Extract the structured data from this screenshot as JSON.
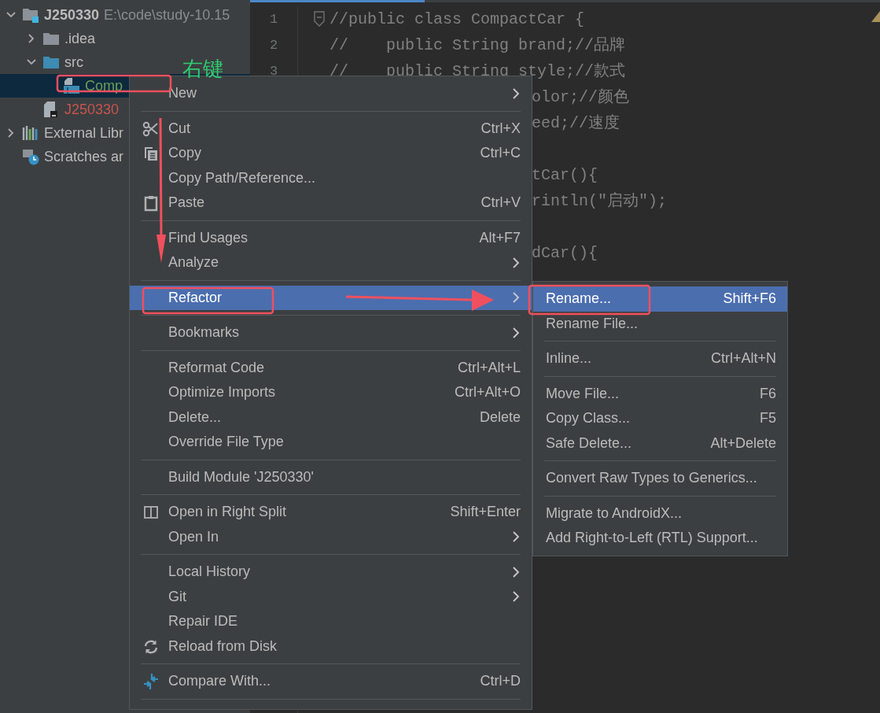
{
  "project_tree": {
    "items": [
      {
        "kind": "module",
        "label": "J250330",
        "path": "E:\\code\\study-10.15",
        "expanded": true,
        "selected": false,
        "children": [
          {
            "kind": "folder",
            "label": ".idea",
            "expanded": false,
            "selected": false
          },
          {
            "kind": "source_folder",
            "label": "src",
            "expanded": true,
            "selected": false,
            "children": [
              {
                "kind": "class",
                "label": "Comp",
                "selected": true
              }
            ]
          },
          {
            "kind": "file",
            "label": "J250330",
            "selected": false
          }
        ]
      },
      {
        "kind": "library",
        "label": "External Libr",
        "expanded": false,
        "selected": false
      },
      {
        "kind": "scratches",
        "label": "Scratches ar",
        "selected": false
      }
    ]
  },
  "editor": {
    "lines": [
      {
        "number": "1",
        "kind": "full",
        "text": "//public class CompactCar {"
      },
      {
        "number": "2",
        "kind": "full",
        "text": "//    public String brand;//品牌"
      },
      {
        "number": "3",
        "kind": "full",
        "text": "//    public String style;//款式"
      },
      {
        "kind": "behind_menu",
        "text": "olor;//颜色"
      },
      {
        "kind": "behind_menu",
        "text": "eed;//速度"
      },
      {
        "kind": "behind_menu"
      },
      {
        "kind": "behind_menu",
        "text": "tCar(){"
      },
      {
        "kind": "behind_menu",
        "text": "rintln(\"启动\");"
      },
      {
        "kind": "behind_menu"
      },
      {
        "kind": "behind_menu",
        "text": "dCar(){"
      }
    ]
  },
  "context_menu": {
    "items": [
      {
        "kind": "item",
        "label": "New",
        "submenu": true,
        "selected": false
      },
      {
        "kind": "separator"
      },
      {
        "kind": "item",
        "label": "Cut",
        "shortcut": "Ctrl+X",
        "submenu": false,
        "selected": false
      },
      {
        "kind": "item",
        "label": "Copy",
        "shortcut": "Ctrl+C",
        "submenu": false,
        "selected": false
      },
      {
        "kind": "item",
        "label": "Copy Path/Reference...",
        "submenu": false,
        "selected": false
      },
      {
        "kind": "item",
        "label": "Paste",
        "shortcut": "Ctrl+V",
        "submenu": false,
        "selected": false
      },
      {
        "kind": "separator"
      },
      {
        "kind": "item",
        "label": "Find Usages",
        "shortcut": "Alt+F7",
        "submenu": false,
        "selected": false
      },
      {
        "kind": "item",
        "label": "Analyze",
        "submenu": true,
        "selected": false
      },
      {
        "kind": "separator"
      },
      {
        "kind": "item",
        "label": "Refactor",
        "submenu": true,
        "selected": true
      },
      {
        "kind": "separator"
      },
      {
        "kind": "item",
        "label": "Bookmarks",
        "submenu": true,
        "selected": false
      },
      {
        "kind": "separator"
      },
      {
        "kind": "item",
        "label": "Reformat Code",
        "shortcut": "Ctrl+Alt+L",
        "submenu": false,
        "selected": false
      },
      {
        "kind": "item",
        "label": "Optimize Imports",
        "shortcut": "Ctrl+Alt+O",
        "submenu": false,
        "selected": false
      },
      {
        "kind": "item",
        "label": "Delete...",
        "shortcut": "Delete",
        "submenu": false,
        "selected": false
      },
      {
        "kind": "item",
        "label": "Override File Type",
        "submenu": false,
        "selected": false
      },
      {
        "kind": "separator"
      },
      {
        "kind": "item",
        "label": "Build Module 'J250330'",
        "submenu": false,
        "selected": false
      },
      {
        "kind": "separator"
      },
      {
        "kind": "item",
        "label": "Open in Right Split",
        "shortcut": "Shift+Enter",
        "submenu": false,
        "selected": false
      },
      {
        "kind": "item",
        "label": "Open In",
        "submenu": true,
        "selected": false
      },
      {
        "kind": "separator"
      },
      {
        "kind": "item",
        "label": "Local History",
        "submenu": true,
        "selected": false
      },
      {
        "kind": "item",
        "label": "Git",
        "submenu": true,
        "selected": false
      },
      {
        "kind": "item",
        "label": "Repair IDE",
        "submenu": false,
        "selected": false
      },
      {
        "kind": "item",
        "label": "Reload from Disk",
        "submenu": false,
        "selected": false
      },
      {
        "kind": "separator"
      },
      {
        "kind": "item",
        "label": "Compare With...",
        "shortcut": "Ctrl+D",
        "submenu": false,
        "selected": false
      },
      {
        "kind": "separator"
      }
    ]
  },
  "refactor_submenu": {
    "items": [
      {
        "kind": "item",
        "label": "Rename...",
        "shortcut": "Shift+F6",
        "submenu": false,
        "selected": true
      },
      {
        "kind": "item",
        "label": "Rename File...",
        "submenu": false,
        "selected": false
      },
      {
        "kind": "separator"
      },
      {
        "kind": "item",
        "label": "Inline...",
        "shortcut": "Ctrl+Alt+N",
        "submenu": false,
        "selected": false
      },
      {
        "kind": "separator"
      },
      {
        "kind": "item",
        "label": "Move File...",
        "shortcut": "F6",
        "submenu": false,
        "selected": false
      },
      {
        "kind": "item",
        "label": "Copy Class...",
        "shortcut": "F5",
        "submenu": false,
        "selected": false
      },
      {
        "kind": "item",
        "label": "Safe Delete...",
        "shortcut": "Alt+Delete",
        "submenu": false,
        "selected": false
      },
      {
        "kind": "separator"
      },
      {
        "kind": "item",
        "label": "Convert Raw Types to Generics...",
        "submenu": false,
        "selected": false
      },
      {
        "kind": "separator"
      },
      {
        "kind": "item",
        "label": "Migrate to AndroidX...",
        "submenu": false,
        "selected": false
      },
      {
        "kind": "item",
        "label": "Add Right-to-Left (RTL) Support...",
        "submenu": false,
        "selected": false
      }
    ]
  },
  "annotation": {
    "label": "右键"
  }
}
